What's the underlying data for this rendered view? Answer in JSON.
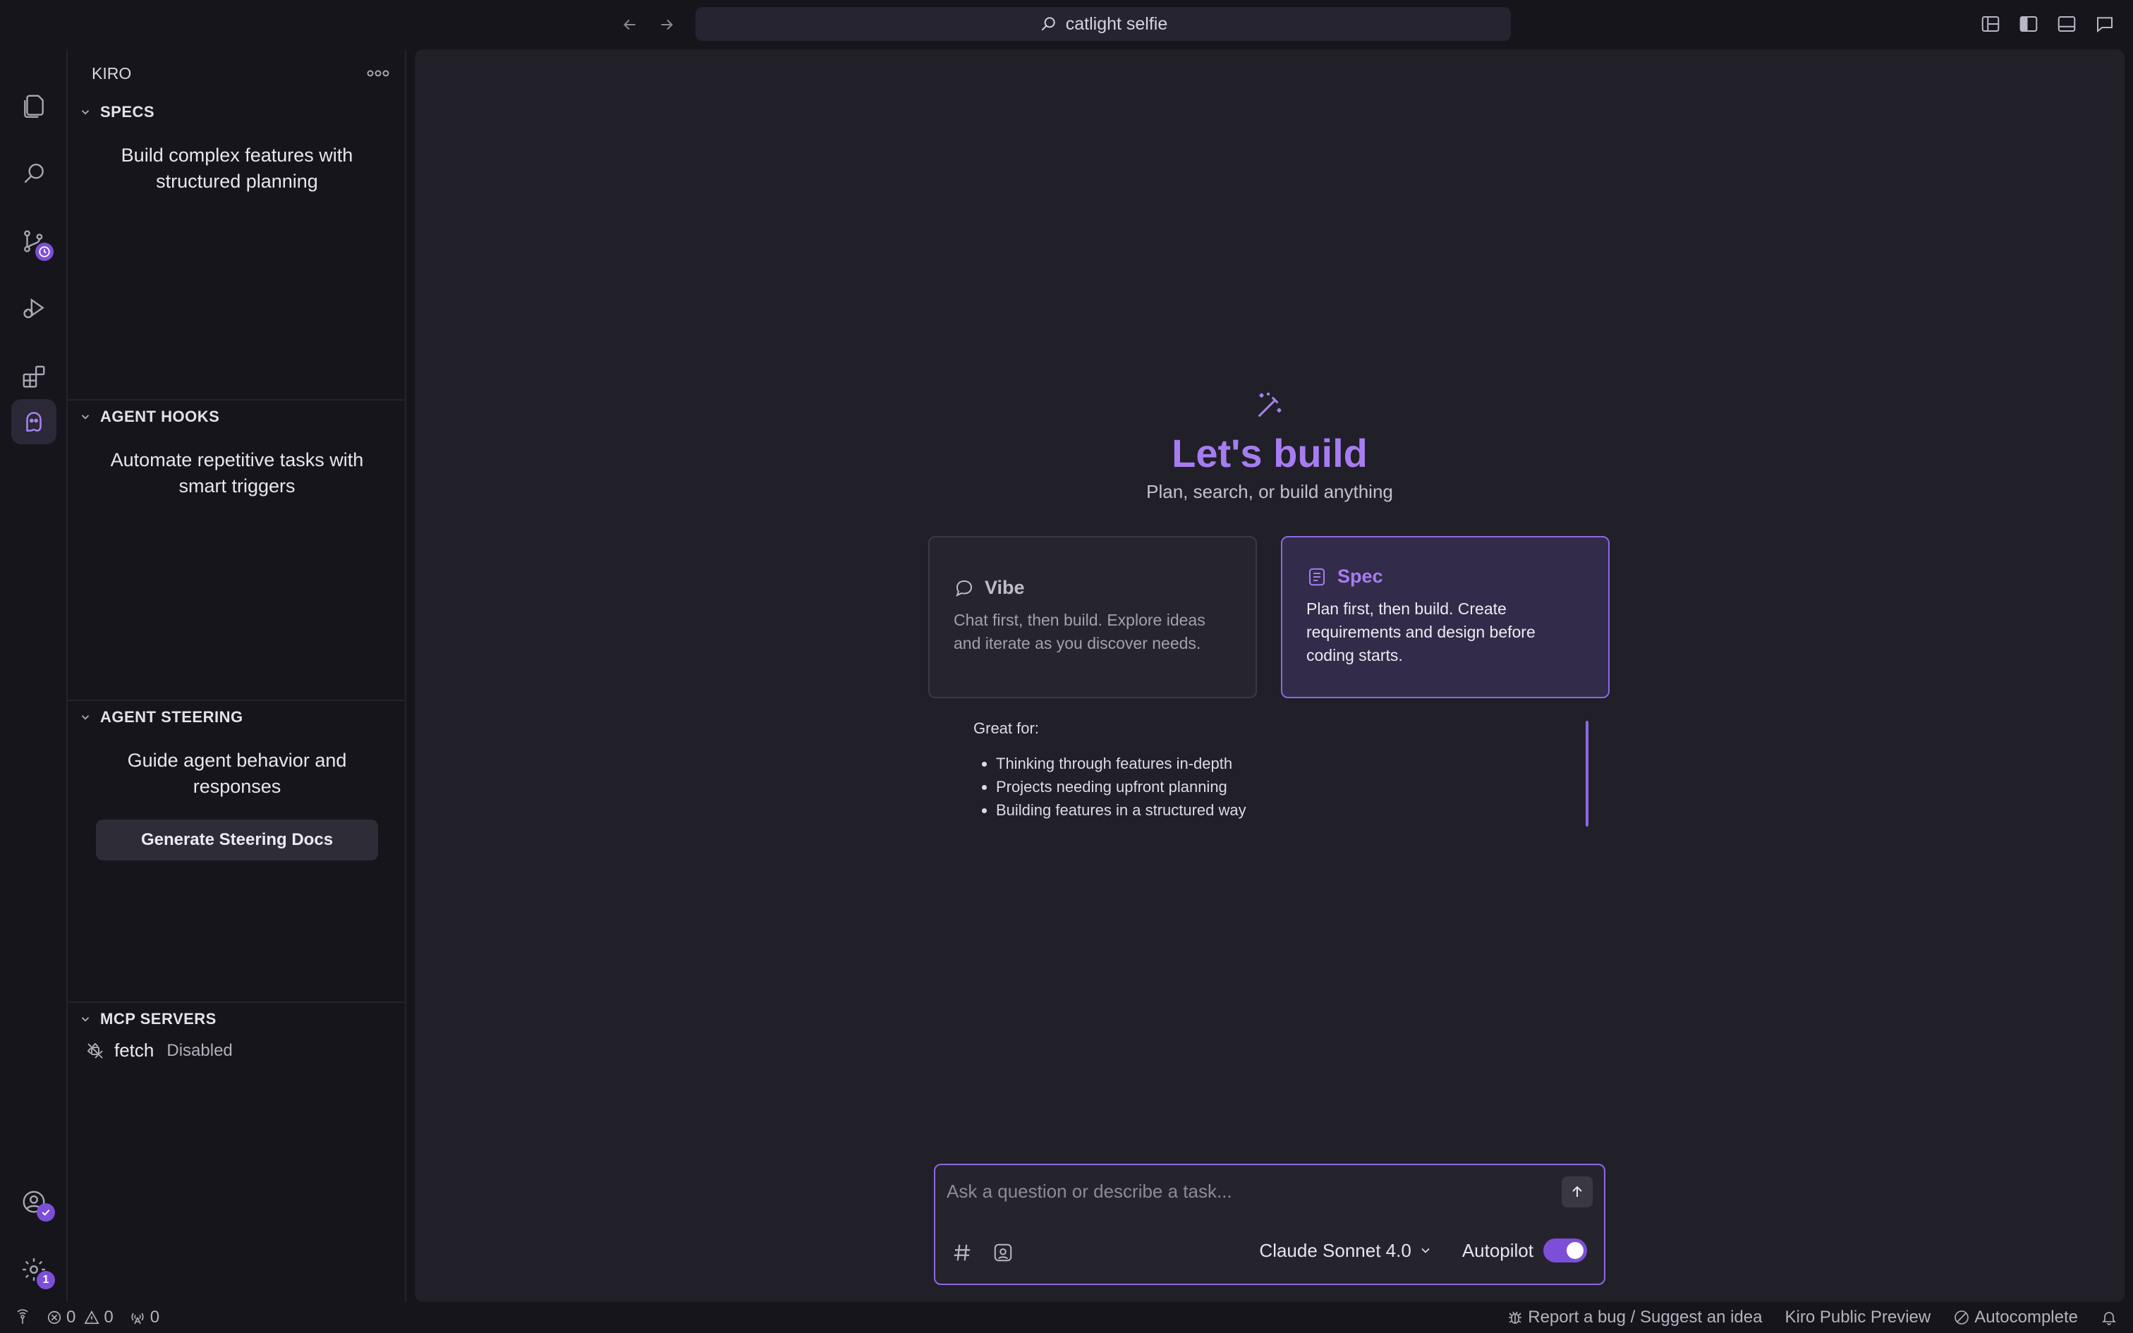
{
  "titlebar": {
    "search_text": "catlight selfie"
  },
  "activity_bar": {
    "source_control_badge": "clock",
    "settings_badge": "1"
  },
  "sidebar": {
    "title": "KIRO",
    "sections": {
      "specs": {
        "heading": "SPECS",
        "description": "Build complex features with structured planning"
      },
      "hooks": {
        "heading": "AGENT HOOKS",
        "description": "Automate repetitive tasks with smart triggers"
      },
      "steering": {
        "heading": "AGENT STEERING",
        "description": "Guide agent behavior and responses",
        "button": "Generate Steering Docs"
      },
      "mcp": {
        "heading": "MCP SERVERS",
        "servers": [
          {
            "name": "fetch",
            "status": "Disabled"
          }
        ]
      }
    }
  },
  "main": {
    "title": "Let's build",
    "subtitle": "Plan, search, or build anything",
    "modes": {
      "vibe": {
        "label": "Vibe",
        "description": "Chat first, then build. Explore ideas and iterate as you discover needs."
      },
      "spec": {
        "label": "Spec",
        "description": "Plan first, then build. Create requirements and design before coding starts."
      }
    },
    "great_for": {
      "title": "Great for:",
      "items": [
        "Thinking through features in-depth",
        "Projects needing upfront planning",
        "Building features in a structured way"
      ]
    },
    "chat": {
      "placeholder": "Ask a question or describe a task...",
      "model": "Claude Sonnet 4.0",
      "autopilot_label": "Autopilot",
      "autopilot_on": true
    }
  },
  "statusbar": {
    "errors": "0",
    "warnings": "0",
    "ports": "0",
    "report_bug": "Report a bug / Suggest an idea",
    "preview": "Kiro Public Preview",
    "autocomplete": "Autocomplete"
  },
  "colors": {
    "accent": "#a67df0",
    "background": "#16151c",
    "editor": "#211f28"
  }
}
